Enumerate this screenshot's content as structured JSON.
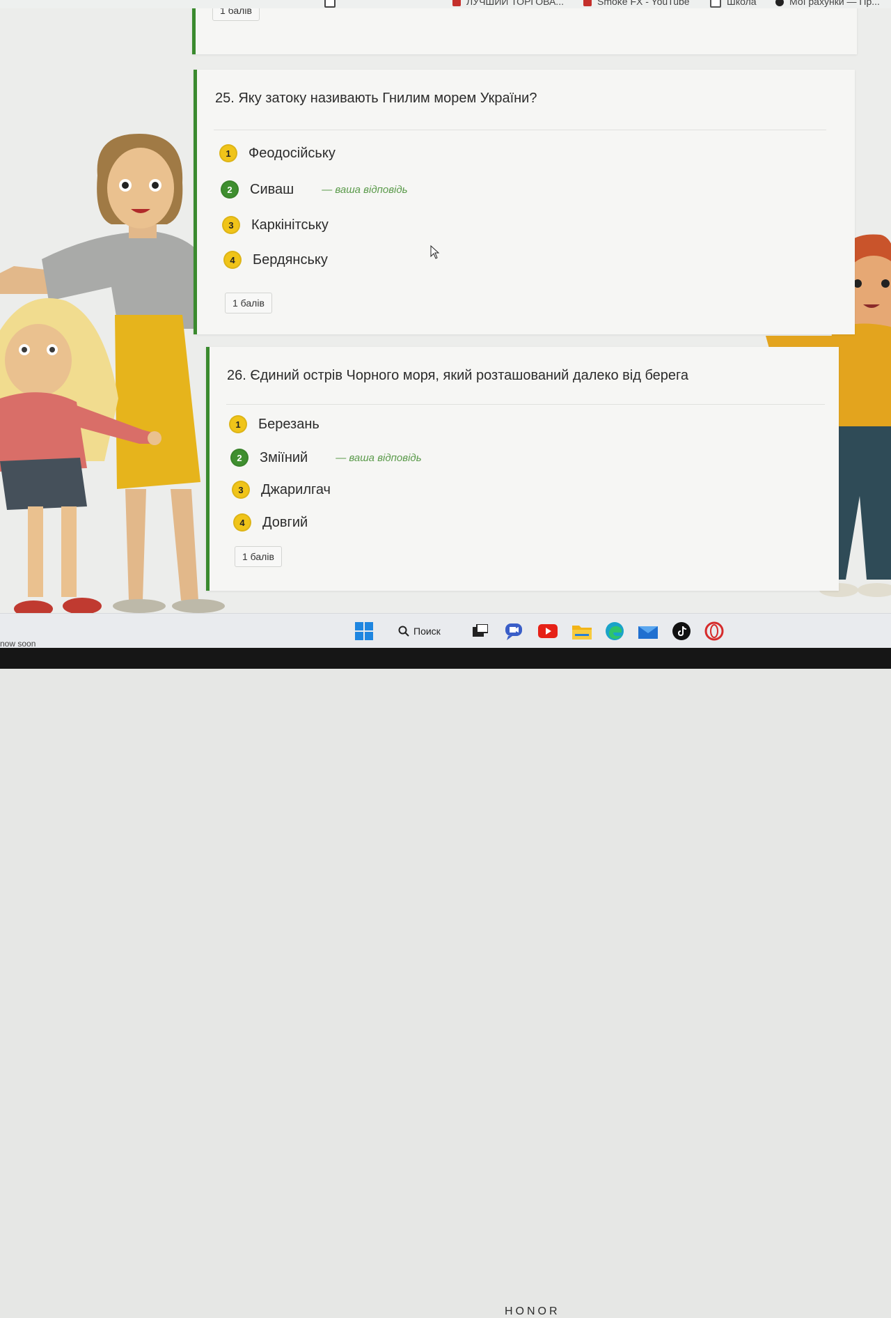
{
  "bookmarks": [
    {
      "label": "",
      "color": "#444444"
    },
    {
      "label": "ЛУЧШИЙ ТОРГОВА...",
      "color": "#c4302b"
    },
    {
      "label": "Smoke FX - YouTube",
      "color": "#c4302b"
    },
    {
      "label": "Школа",
      "color": "#555555"
    },
    {
      "label": "Мої рахунки — Пр...",
      "color": "#222222"
    }
  ],
  "previous_card": {
    "points": "1 балів"
  },
  "questions": [
    {
      "title": "25. Яку затоку називають Гнилим морем України?",
      "options": [
        {
          "num": "1",
          "label": "Феодосійську",
          "color": "yellow",
          "note": ""
        },
        {
          "num": "2",
          "label": "Сиваш",
          "color": "green",
          "note": "— ваша відповідь"
        },
        {
          "num": "3",
          "label": "Каркінітську",
          "color": "yellow",
          "note": ""
        },
        {
          "num": "4",
          "label": "Бердянську",
          "color": "yellow",
          "note": ""
        }
      ],
      "points": "1 балів"
    },
    {
      "title": "26. Єдиний острів Чорного моря, який розташований далеко від берега",
      "options": [
        {
          "num": "1",
          "label": "Березань",
          "color": "yellow",
          "note": ""
        },
        {
          "num": "2",
          "label": "Зміїний",
          "color": "green",
          "note": "— ваша відповідь"
        },
        {
          "num": "3",
          "label": "Джарилгач",
          "color": "yellow",
          "note": ""
        },
        {
          "num": "4",
          "label": "Довгий",
          "color": "yellow",
          "note": ""
        }
      ],
      "points": "1 балів"
    }
  ],
  "taskbar": {
    "search_label": "Поиск",
    "icons": [
      "windows-start",
      "search",
      "task-view",
      "meet",
      "youtube",
      "file-explorer",
      "edge",
      "mail",
      "tiktok",
      "opera"
    ]
  },
  "status_text": "now soon",
  "brand": "HONOR",
  "colors": {
    "accent_green": "#3a8a2e",
    "badge_yellow": "#f0c419",
    "badge_green": "#3f8f2f"
  }
}
